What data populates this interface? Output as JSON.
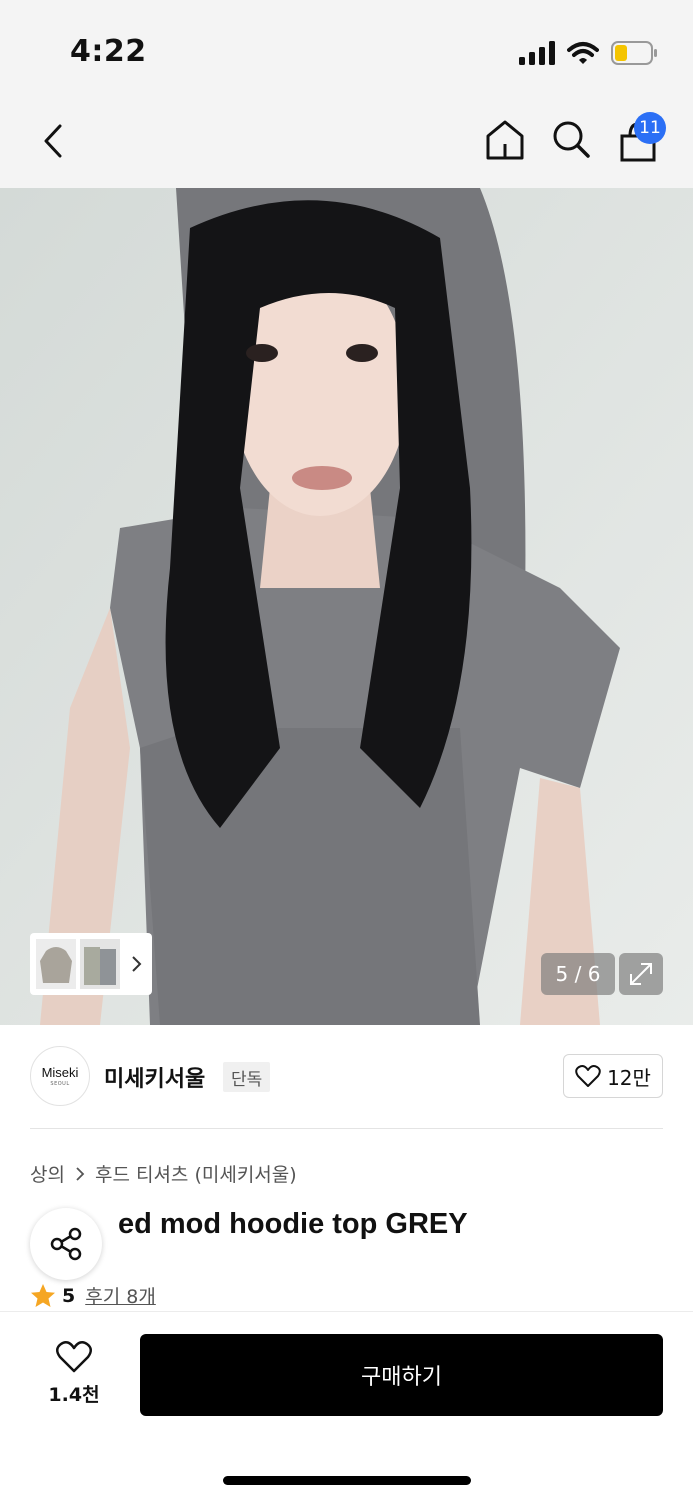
{
  "status_bar": {
    "time": "4:22"
  },
  "nav": {
    "cart_badge": "11"
  },
  "gallery": {
    "page_counter": "5 / 6"
  },
  "brand": {
    "logo_text": "Miseki",
    "logo_subtext": "SEOUL",
    "name": "미세키서울",
    "tag": "단독",
    "like_count": "12만"
  },
  "breadcrumb": {
    "category": "상의",
    "subcategory": "후드 티셔츠 (미세키서울)"
  },
  "product": {
    "title_visible": "ed mod hoodie top GREY",
    "rating": "5",
    "reviews_label": "후기 8개"
  },
  "bottom_bar": {
    "wish_count": "1.4천",
    "buy_label": "구매하기"
  },
  "colors": {
    "accent_blue": "#2b6ff5",
    "star": "#f5a623",
    "buy_button": "#000000"
  }
}
